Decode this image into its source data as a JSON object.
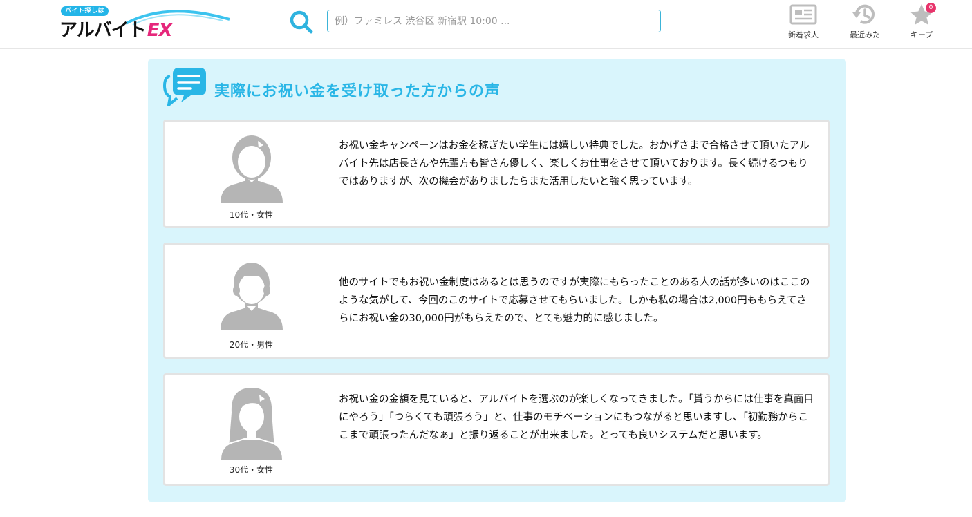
{
  "header": {
    "logo": {
      "tagline": "バイト探しは",
      "name_main": "アルバイト",
      "name_ex": "EX"
    },
    "search": {
      "placeholder": "例）ファミレス 渋谷区 新宿駅 10:00 ..."
    },
    "nav": [
      {
        "label": "新着求人",
        "icon": "newspaper-icon"
      },
      {
        "label": "最近みた",
        "icon": "history-icon"
      },
      {
        "label": "キープ",
        "icon": "star-icon",
        "badge": "0"
      }
    ]
  },
  "section": {
    "title": "実際にお祝い金を受け取った方からの声",
    "icon": "chat-bubble-icon"
  },
  "testimonials": [
    {
      "caption": "10代・女性",
      "avatar": "female-avatar-icon",
      "text": "お祝い金キャンペーンはお金を稼ぎたい学生には嬉しい特典でした。おかげさまで合格させて頂いたアルバイト先は店長さんや先輩方も皆さん優しく、楽しくお仕事をさせて頂いております。長く続けるつもりではありますが、次の機会がありましたらまた活用したいと強く思っています。"
    },
    {
      "caption": "20代・男性",
      "avatar": "male-avatar-icon",
      "text": "他のサイトでもお祝い金制度はあるとは思うのですが実際にもらったことのある人の話が多いのはここのような気がして、今回のこのサイトで応募させてもらいました。しかも私の場合は2,000円ももらえてさらにお祝い金の30,000円がもらえたので、とても魅力的に感じました。"
    },
    {
      "caption": "30代・女性",
      "avatar": "female-longhair-avatar-icon",
      "text": "お祝い金の金額を見ていると、アルバイトを選ぶのが楽しくなってきました。「貰うからには仕事を真面目にやろう」「つらくても頑張ろう」と、仕事のモチベーションにもつながると思いますし、「初勤務からここまで頑張ったんだなぁ」と振り返ることが出来ました。とっても良いシステムだと思います。"
    }
  ],
  "colors": {
    "accent": "#29b6e6",
    "panel_bg": "#d9f5fc",
    "badge": "#e8336b",
    "logo_ex": "#e6277b",
    "avatar_gray": "#b5b5b5"
  }
}
